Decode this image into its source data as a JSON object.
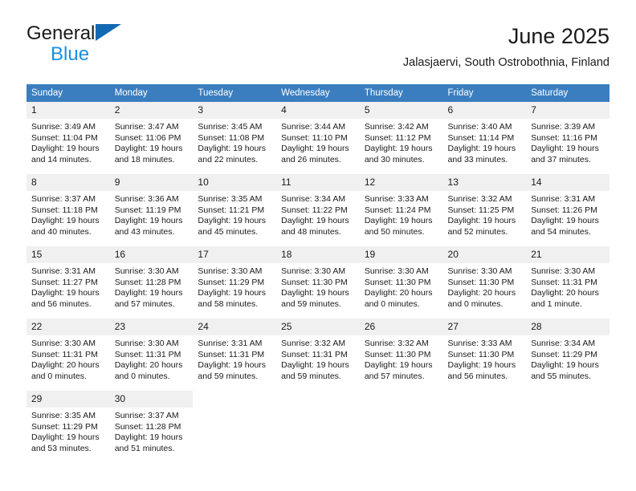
{
  "brand": {
    "name_top": "General",
    "name_bottom": "Blue",
    "flag_color": "#1268b3",
    "blue_text_color": "#1a8fe0"
  },
  "header": {
    "title": "June 2025",
    "subtitle": "Jalasjaervi, South Ostrobothnia, Finland"
  },
  "theme": {
    "header_bg": "#3b7ebf",
    "header_text": "#ffffff",
    "daynum_bg": "#f0f0f0",
    "grid_line": "#5b5b5b"
  },
  "weekday_headers": [
    "Sunday",
    "Monday",
    "Tuesday",
    "Wednesday",
    "Thursday",
    "Friday",
    "Saturday"
  ],
  "weeks": [
    [
      {
        "day": "1",
        "sunrise": "Sunrise: 3:49 AM",
        "sunset": "Sunset: 11:04 PM",
        "daylight1": "Daylight: 19 hours",
        "daylight2": "and 14 minutes."
      },
      {
        "day": "2",
        "sunrise": "Sunrise: 3:47 AM",
        "sunset": "Sunset: 11:06 PM",
        "daylight1": "Daylight: 19 hours",
        "daylight2": "and 18 minutes."
      },
      {
        "day": "3",
        "sunrise": "Sunrise: 3:45 AM",
        "sunset": "Sunset: 11:08 PM",
        "daylight1": "Daylight: 19 hours",
        "daylight2": "and 22 minutes."
      },
      {
        "day": "4",
        "sunrise": "Sunrise: 3:44 AM",
        "sunset": "Sunset: 11:10 PM",
        "daylight1": "Daylight: 19 hours",
        "daylight2": "and 26 minutes."
      },
      {
        "day": "5",
        "sunrise": "Sunrise: 3:42 AM",
        "sunset": "Sunset: 11:12 PM",
        "daylight1": "Daylight: 19 hours",
        "daylight2": "and 30 minutes."
      },
      {
        "day": "6",
        "sunrise": "Sunrise: 3:40 AM",
        "sunset": "Sunset: 11:14 PM",
        "daylight1": "Daylight: 19 hours",
        "daylight2": "and 33 minutes."
      },
      {
        "day": "7",
        "sunrise": "Sunrise: 3:39 AM",
        "sunset": "Sunset: 11:16 PM",
        "daylight1": "Daylight: 19 hours",
        "daylight2": "and 37 minutes."
      }
    ],
    [
      {
        "day": "8",
        "sunrise": "Sunrise: 3:37 AM",
        "sunset": "Sunset: 11:18 PM",
        "daylight1": "Daylight: 19 hours",
        "daylight2": "and 40 minutes."
      },
      {
        "day": "9",
        "sunrise": "Sunrise: 3:36 AM",
        "sunset": "Sunset: 11:19 PM",
        "daylight1": "Daylight: 19 hours",
        "daylight2": "and 43 minutes."
      },
      {
        "day": "10",
        "sunrise": "Sunrise: 3:35 AM",
        "sunset": "Sunset: 11:21 PM",
        "daylight1": "Daylight: 19 hours",
        "daylight2": "and 45 minutes."
      },
      {
        "day": "11",
        "sunrise": "Sunrise: 3:34 AM",
        "sunset": "Sunset: 11:22 PM",
        "daylight1": "Daylight: 19 hours",
        "daylight2": "and 48 minutes."
      },
      {
        "day": "12",
        "sunrise": "Sunrise: 3:33 AM",
        "sunset": "Sunset: 11:24 PM",
        "daylight1": "Daylight: 19 hours",
        "daylight2": "and 50 minutes."
      },
      {
        "day": "13",
        "sunrise": "Sunrise: 3:32 AM",
        "sunset": "Sunset: 11:25 PM",
        "daylight1": "Daylight: 19 hours",
        "daylight2": "and 52 minutes."
      },
      {
        "day": "14",
        "sunrise": "Sunrise: 3:31 AM",
        "sunset": "Sunset: 11:26 PM",
        "daylight1": "Daylight: 19 hours",
        "daylight2": "and 54 minutes."
      }
    ],
    [
      {
        "day": "15",
        "sunrise": "Sunrise: 3:31 AM",
        "sunset": "Sunset: 11:27 PM",
        "daylight1": "Daylight: 19 hours",
        "daylight2": "and 56 minutes."
      },
      {
        "day": "16",
        "sunrise": "Sunrise: 3:30 AM",
        "sunset": "Sunset: 11:28 PM",
        "daylight1": "Daylight: 19 hours",
        "daylight2": "and 57 minutes."
      },
      {
        "day": "17",
        "sunrise": "Sunrise: 3:30 AM",
        "sunset": "Sunset: 11:29 PM",
        "daylight1": "Daylight: 19 hours",
        "daylight2": "and 58 minutes."
      },
      {
        "day": "18",
        "sunrise": "Sunrise: 3:30 AM",
        "sunset": "Sunset: 11:30 PM",
        "daylight1": "Daylight: 19 hours",
        "daylight2": "and 59 minutes."
      },
      {
        "day": "19",
        "sunrise": "Sunrise: 3:30 AM",
        "sunset": "Sunset: 11:30 PM",
        "daylight1": "Daylight: 20 hours",
        "daylight2": "and 0 minutes."
      },
      {
        "day": "20",
        "sunrise": "Sunrise: 3:30 AM",
        "sunset": "Sunset: 11:30 PM",
        "daylight1": "Daylight: 20 hours",
        "daylight2": "and 0 minutes."
      },
      {
        "day": "21",
        "sunrise": "Sunrise: 3:30 AM",
        "sunset": "Sunset: 11:31 PM",
        "daylight1": "Daylight: 20 hours",
        "daylight2": "and 1 minute."
      }
    ],
    [
      {
        "day": "22",
        "sunrise": "Sunrise: 3:30 AM",
        "sunset": "Sunset: 11:31 PM",
        "daylight1": "Daylight: 20 hours",
        "daylight2": "and 0 minutes."
      },
      {
        "day": "23",
        "sunrise": "Sunrise: 3:30 AM",
        "sunset": "Sunset: 11:31 PM",
        "daylight1": "Daylight: 20 hours",
        "daylight2": "and 0 minutes."
      },
      {
        "day": "24",
        "sunrise": "Sunrise: 3:31 AM",
        "sunset": "Sunset: 11:31 PM",
        "daylight1": "Daylight: 19 hours",
        "daylight2": "and 59 minutes."
      },
      {
        "day": "25",
        "sunrise": "Sunrise: 3:32 AM",
        "sunset": "Sunset: 11:31 PM",
        "daylight1": "Daylight: 19 hours",
        "daylight2": "and 59 minutes."
      },
      {
        "day": "26",
        "sunrise": "Sunrise: 3:32 AM",
        "sunset": "Sunset: 11:30 PM",
        "daylight1": "Daylight: 19 hours",
        "daylight2": "and 57 minutes."
      },
      {
        "day": "27",
        "sunrise": "Sunrise: 3:33 AM",
        "sunset": "Sunset: 11:30 PM",
        "daylight1": "Daylight: 19 hours",
        "daylight2": "and 56 minutes."
      },
      {
        "day": "28",
        "sunrise": "Sunrise: 3:34 AM",
        "sunset": "Sunset: 11:29 PM",
        "daylight1": "Daylight: 19 hours",
        "daylight2": "and 55 minutes."
      }
    ],
    [
      {
        "day": "29",
        "sunrise": "Sunrise: 3:35 AM",
        "sunset": "Sunset: 11:29 PM",
        "daylight1": "Daylight: 19 hours",
        "daylight2": "and 53 minutes."
      },
      {
        "day": "30",
        "sunrise": "Sunrise: 3:37 AM",
        "sunset": "Sunset: 11:28 PM",
        "daylight1": "Daylight: 19 hours",
        "daylight2": "and 51 minutes."
      },
      {
        "day": "",
        "sunrise": "",
        "sunset": "",
        "daylight1": "",
        "daylight2": ""
      },
      {
        "day": "",
        "sunrise": "",
        "sunset": "",
        "daylight1": "",
        "daylight2": ""
      },
      {
        "day": "",
        "sunrise": "",
        "sunset": "",
        "daylight1": "",
        "daylight2": ""
      },
      {
        "day": "",
        "sunrise": "",
        "sunset": "",
        "daylight1": "",
        "daylight2": ""
      },
      {
        "day": "",
        "sunrise": "",
        "sunset": "",
        "daylight1": "",
        "daylight2": ""
      }
    ]
  ]
}
